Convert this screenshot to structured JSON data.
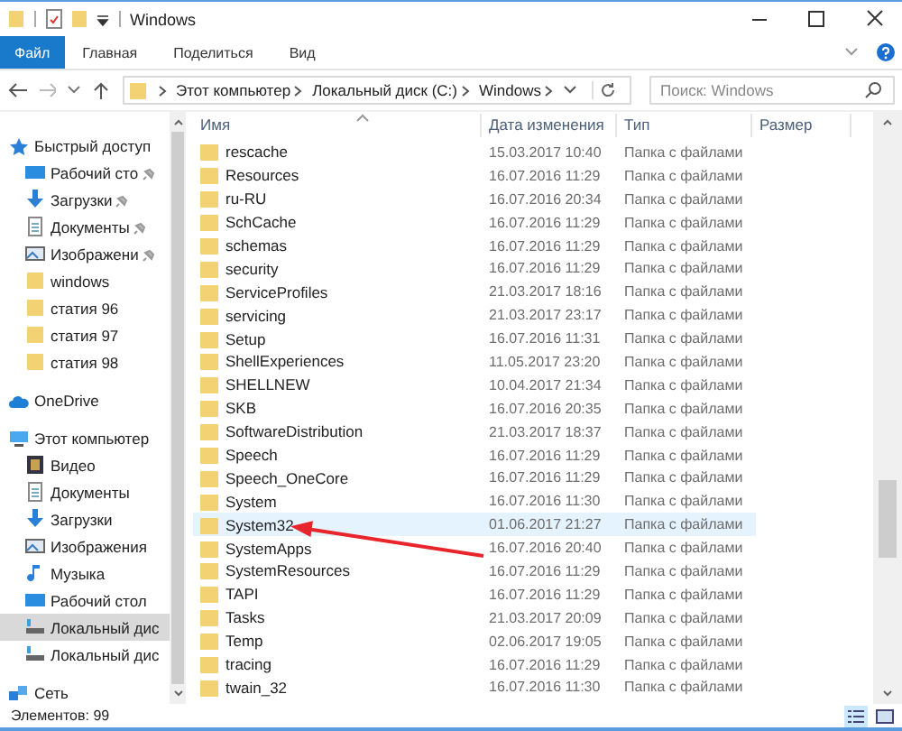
{
  "window": {
    "title": "Windows"
  },
  "ribbon_tabs": [
    {
      "label": "Файл",
      "selected": true
    },
    {
      "label": "Главная",
      "selected": false
    },
    {
      "label": "Поделиться",
      "selected": false
    },
    {
      "label": "Вид",
      "selected": false
    }
  ],
  "address": {
    "crumbs": [
      "Этот компьютер",
      "Локальный диск (C:)",
      "Windows"
    ]
  },
  "search": {
    "placeholder": "Поиск: Windows"
  },
  "sidebar": {
    "items": [
      {
        "label": "Быстрый доступ",
        "kind": "star",
        "selected": false,
        "children": [
          {
            "label": "Рабочий сто",
            "kind": "desktop",
            "pinned": true,
            "selected": false
          },
          {
            "label": "Загрузки",
            "kind": "download",
            "pinned": true,
            "selected": false
          },
          {
            "label": "Документы",
            "kind": "document",
            "pinned": true,
            "selected": false
          },
          {
            "label": "Изображени",
            "kind": "image",
            "pinned": true,
            "selected": false
          },
          {
            "label": "windows",
            "kind": "folder",
            "pinned": false,
            "selected": false
          },
          {
            "label": "статия 96",
            "kind": "folder",
            "pinned": false,
            "selected": false
          },
          {
            "label": "статия 97",
            "kind": "folder",
            "pinned": false,
            "selected": false
          },
          {
            "label": "статия 98",
            "kind": "folder",
            "pinned": false,
            "selected": false
          }
        ]
      },
      {
        "label": "OneDrive",
        "kind": "cloud",
        "selected": false
      },
      {
        "label": "Этот компьютер",
        "kind": "pc",
        "selected": false,
        "children": [
          {
            "label": "Видео",
            "kind": "video",
            "selected": false
          },
          {
            "label": "Документы",
            "kind": "document",
            "selected": false
          },
          {
            "label": "Загрузки",
            "kind": "download",
            "selected": false
          },
          {
            "label": "Изображения",
            "kind": "image",
            "selected": false
          },
          {
            "label": "Музыка",
            "kind": "music",
            "selected": false
          },
          {
            "label": "Рабочий стол",
            "kind": "desktop",
            "selected": false
          },
          {
            "label": "Локальный дис",
            "kind": "drive",
            "selected": true
          },
          {
            "label": "Локальный дис",
            "kind": "drive",
            "selected": false
          }
        ]
      },
      {
        "label": "Сеть",
        "kind": "network",
        "selected": false
      }
    ]
  },
  "table": {
    "columns": [
      "Имя",
      "Дата изменения",
      "Тип",
      "Размер"
    ],
    "rows": [
      {
        "name": "rescache",
        "date": "15.03.2017 10:40",
        "type": "Папка с файлами",
        "selected": false
      },
      {
        "name": "Resources",
        "date": "16.07.2016 11:29",
        "type": "Папка с файлами",
        "selected": false
      },
      {
        "name": "ru-RU",
        "date": "16.07.2016 20:34",
        "type": "Папка с файлами",
        "selected": false
      },
      {
        "name": "SchCache",
        "date": "16.07.2016 11:29",
        "type": "Папка с файлами",
        "selected": false
      },
      {
        "name": "schemas",
        "date": "16.07.2016 11:29",
        "type": "Папка с файлами",
        "selected": false
      },
      {
        "name": "security",
        "date": "16.07.2016 11:29",
        "type": "Папка с файлами",
        "selected": false
      },
      {
        "name": "ServiceProfiles",
        "date": "21.03.2017 18:16",
        "type": "Папка с файлами",
        "selected": false
      },
      {
        "name": "servicing",
        "date": "21.03.2017 23:17",
        "type": "Папка с файлами",
        "selected": false
      },
      {
        "name": "Setup",
        "date": "16.07.2016 11:31",
        "type": "Папка с файлами",
        "selected": false
      },
      {
        "name": "ShellExperiences",
        "date": "11.05.2017 23:20",
        "type": "Папка с файлами",
        "selected": false
      },
      {
        "name": "SHELLNEW",
        "date": "10.04.2017 21:34",
        "type": "Папка с файлами",
        "selected": false
      },
      {
        "name": "SKB",
        "date": "16.07.2016 20:35",
        "type": "Папка с файлами",
        "selected": false
      },
      {
        "name": "SoftwareDistribution",
        "date": "21.03.2017 18:37",
        "type": "Папка с файлами",
        "selected": false
      },
      {
        "name": "Speech",
        "date": "16.07.2016 11:29",
        "type": "Папка с файлами",
        "selected": false
      },
      {
        "name": "Speech_OneCore",
        "date": "16.07.2016 11:29",
        "type": "Папка с файлами",
        "selected": false
      },
      {
        "name": "System",
        "date": "16.07.2016 11:30",
        "type": "Папка с файлами",
        "selected": false
      },
      {
        "name": "System32",
        "date": "01.06.2017 21:27",
        "type": "Папка с файлами",
        "selected": true
      },
      {
        "name": "SystemApps",
        "date": "16.07.2016 20:40",
        "type": "Папка с файлами",
        "selected": false
      },
      {
        "name": "SystemResources",
        "date": "16.07.2016 11:29",
        "type": "Папка с файлами",
        "selected": false
      },
      {
        "name": "TAPI",
        "date": "16.07.2016 11:29",
        "type": "Папка с файлами",
        "selected": false
      },
      {
        "name": "Tasks",
        "date": "21.03.2017 20:09",
        "type": "Папка с файлами",
        "selected": false
      },
      {
        "name": "Temp",
        "date": "02.06.2017 19:05",
        "type": "Папка с файлами",
        "selected": false
      },
      {
        "name": "tracing",
        "date": "16.07.2016 11:29",
        "type": "Папка с файлами",
        "selected": false
      },
      {
        "name": "twain_32",
        "date": "16.07.2016 11:30",
        "type": "Папка с файлами",
        "selected": false
      }
    ]
  },
  "status_bar": {
    "count": "Элементов: 99"
  }
}
